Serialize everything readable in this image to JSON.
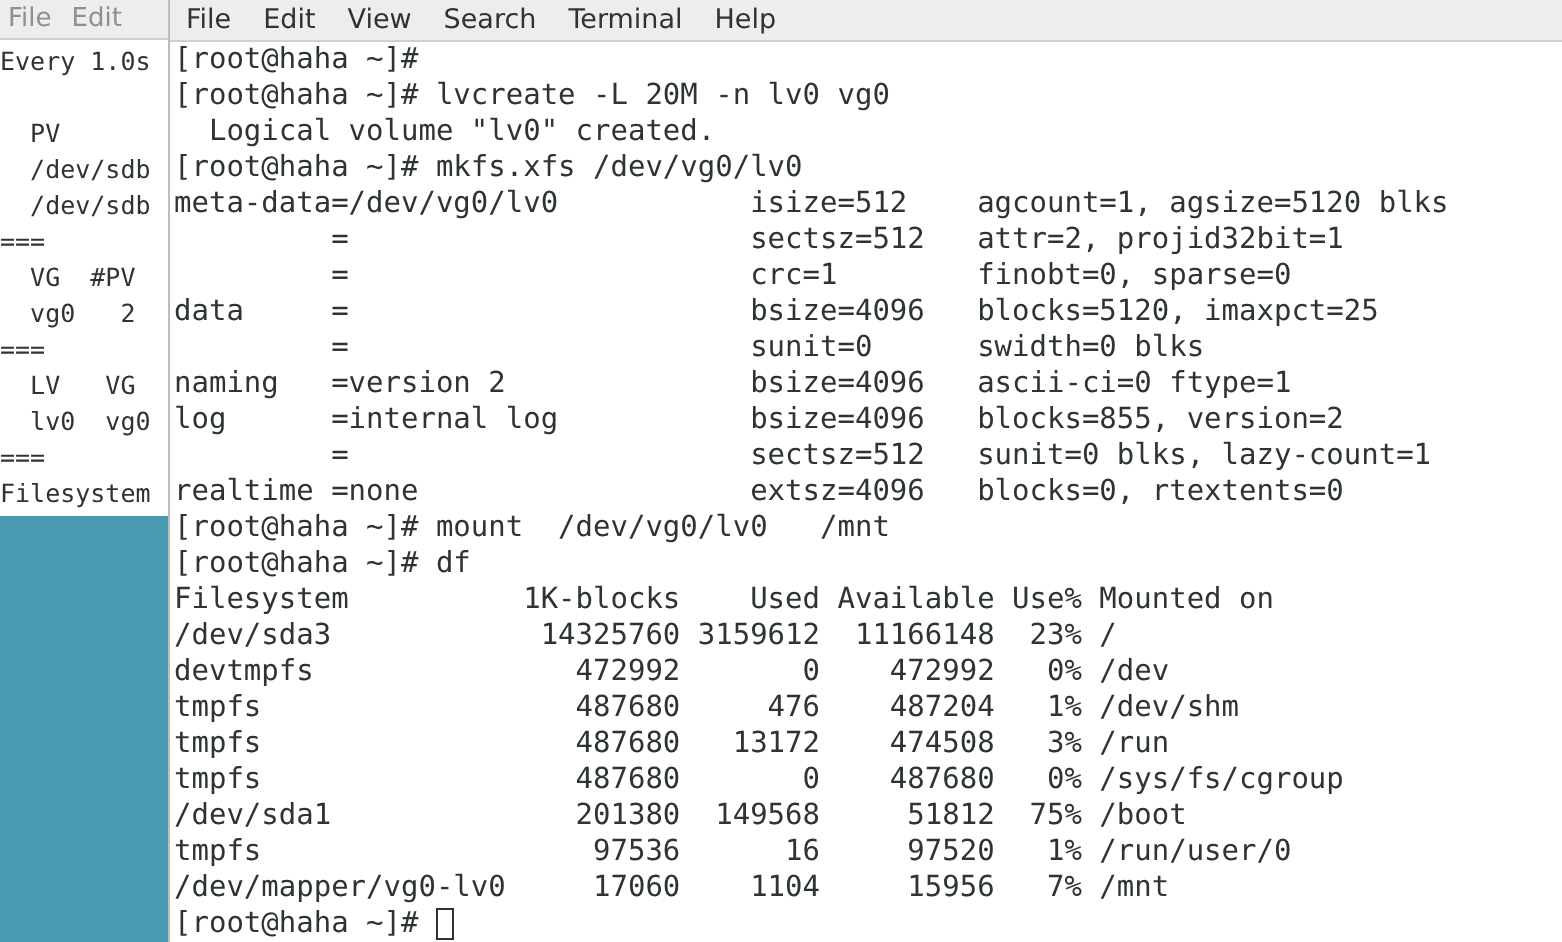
{
  "back_window": {
    "menu": [
      "File",
      "Edit"
    ],
    "header": "Every 1.0s",
    "lines": [
      "  PV",
      "  /dev/sdb",
      "  /dev/sdb",
      "===",
      "  VG  #PV",
      "  vg0   2",
      "===",
      "  LV   VG",
      "  lv0  vg0",
      "===",
      "Filesystem"
    ]
  },
  "terminal": {
    "menu": [
      "File",
      "Edit",
      "View",
      "Search",
      "Terminal",
      "Help"
    ],
    "lines": [
      "[root@haha ~]#",
      "[root@haha ~]# lvcreate -L 20M -n lv0 vg0",
      "  Logical volume \"lv0\" created.",
      "[root@haha ~]# mkfs.xfs /dev/vg0/lv0",
      "meta-data=/dev/vg0/lv0           isize=512    agcount=1, agsize=5120 blks",
      "         =                       sectsz=512   attr=2, projid32bit=1",
      "         =                       crc=1        finobt=0, sparse=0",
      "data     =                       bsize=4096   blocks=5120, imaxpct=25",
      "         =                       sunit=0      swidth=0 blks",
      "naming   =version 2              bsize=4096   ascii-ci=0 ftype=1",
      "log      =internal log           bsize=4096   blocks=855, version=2",
      "         =                       sectsz=512   sunit=0 blks, lazy-count=1",
      "realtime =none                   extsz=4096   blocks=0, rtextents=0",
      "[root@haha ~]# mount  /dev/vg0/lv0   /mnt",
      "[root@haha ~]# df",
      "Filesystem          1K-blocks    Used Available Use% Mounted on",
      "/dev/sda3            14325760 3159612  11166148  23% /",
      "devtmpfs               472992       0    472992   0% /dev",
      "tmpfs                  487680     476    487204   1% /dev/shm",
      "tmpfs                  487680   13172    474508   3% /run",
      "tmpfs                  487680       0    487680   0% /sys/fs/cgroup",
      "/dev/sda1              201380  149568     51812  75% /boot",
      "tmpfs                   97536      16     97520   1% /run/user/0",
      "/dev/mapper/vg0-lv0     17060    1104     15956   7% /mnt"
    ],
    "prompt": "[root@haha ~]#"
  }
}
